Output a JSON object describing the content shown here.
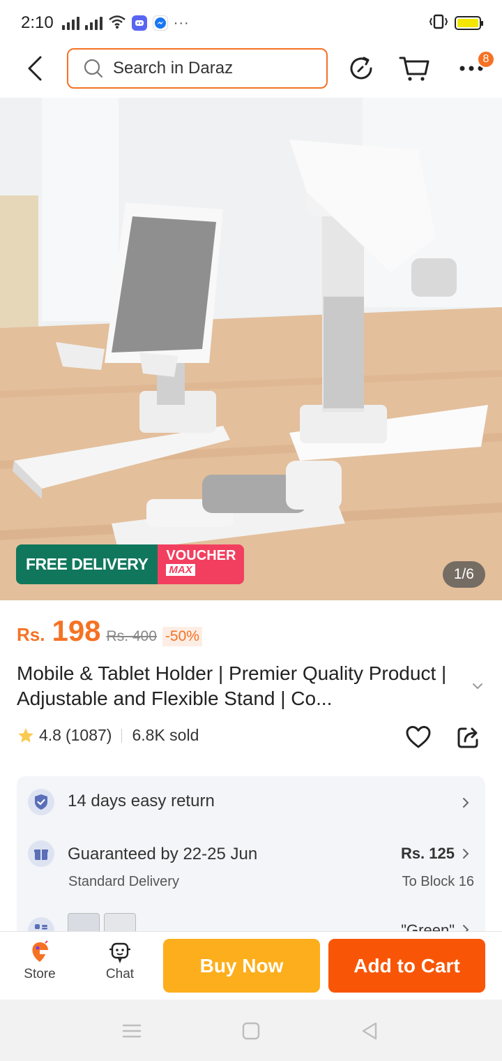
{
  "status_bar": {
    "time": "2:10",
    "icons": [
      "signal-icon",
      "signal-icon",
      "wifi-icon",
      "discord-icon",
      "messenger-icon",
      "more-icon",
      "vibrate-icon",
      "battery-icon"
    ],
    "more": "···"
  },
  "header": {
    "search_placeholder": "Search in Daraz",
    "notification_count": "8",
    "colors": {
      "accent": "#f57224"
    }
  },
  "hero": {
    "badge_free": "FREE DELIVERY",
    "badge_voucher": "VOUCHER",
    "badge_max": "MAX",
    "counter": "1/6"
  },
  "product": {
    "currency": "Rs.",
    "price": "198",
    "old_price": "Rs. 400",
    "discount": "-50%",
    "title": "Mobile & Tablet Holder | Premier Quality Product | Adjustable and Flexible Stand | Co...",
    "rating": "4.8",
    "reviews": "(1087)",
    "sold": "6.8K sold"
  },
  "services": {
    "return_label": "14 days easy return",
    "delivery_label": "Guaranteed by 22-25 Jun",
    "delivery_sub": "Standard Delivery",
    "delivery_price": "Rs. 125",
    "delivery_location": "To Block 16",
    "variant_label": "\"Green\""
  },
  "bottom_bar": {
    "store_label": "Store",
    "chat_label": "Chat",
    "buy_now": "Buy Now",
    "add_to_cart": "Add to Cart",
    "colors": {
      "buy": "#fdae1c",
      "cart": "#f85606"
    }
  }
}
